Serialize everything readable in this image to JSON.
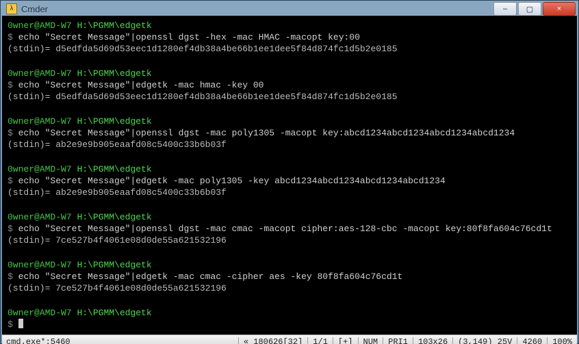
{
  "window": {
    "title": "Cmder",
    "icon_glyph": "λ",
    "controls": {
      "min": "–",
      "max": "▢",
      "close": "×"
    }
  },
  "prompt": {
    "user": "0wner@AMD-W7",
    "path": "H:\\PGMM\\edgetk",
    "symbol": "$"
  },
  "blocks": [
    {
      "cmd": "echo \"Secret Message\"|openssl dgst -hex -mac HMAC -macopt key:00",
      "out": "(stdin)= d5edfda5d69d53eec1d1280ef4db38a4be66b1ee1dee5f84d874fc1d5b2e0185"
    },
    {
      "cmd": "echo \"Secret Message\"|edgetk -mac hmac -key 00",
      "out": "(stdin)= d5edfda5d69d53eec1d1280ef4db38a4be66b1ee1dee5f84d874fc1d5b2e0185"
    },
    {
      "cmd": "echo \"Secret Message\"|openssl dgst -mac poly1305 -macopt key:abcd1234abcd1234abcd1234abcd1234",
      "out": "(stdin)= ab2e9e9b905eaafd08c5400c33b6b03f"
    },
    {
      "cmd": "echo \"Secret Message\"|edgetk -mac poly1305 -key abcd1234abcd1234abcd1234abcd1234",
      "out": "(stdin)= ab2e9e9b905eaafd08c5400c33b6b03f"
    },
    {
      "cmd": "echo \"Secret Message\"|openssl dgst -mac cmac -macopt cipher:aes-128-cbc -macopt key:80f8fa604c76cd1t",
      "out": "(stdin)= 7ce527b4f4061e08d0de55a621532196"
    },
    {
      "cmd": "echo \"Secret Message\"|edgetk -mac cmac -cipher aes -key 80f8fa604c76cd1t",
      "out": "(stdin)= 7ce527b4f4061e08d0de55a621532196"
    }
  ],
  "statusbar": {
    "left": "cmd.exe*:5460",
    "items": [
      "« 180626[32]",
      "1/1",
      "[+]",
      "NUM",
      "PRI1",
      "103x26",
      "(3,149) 25V",
      "4260",
      "100%"
    ]
  }
}
